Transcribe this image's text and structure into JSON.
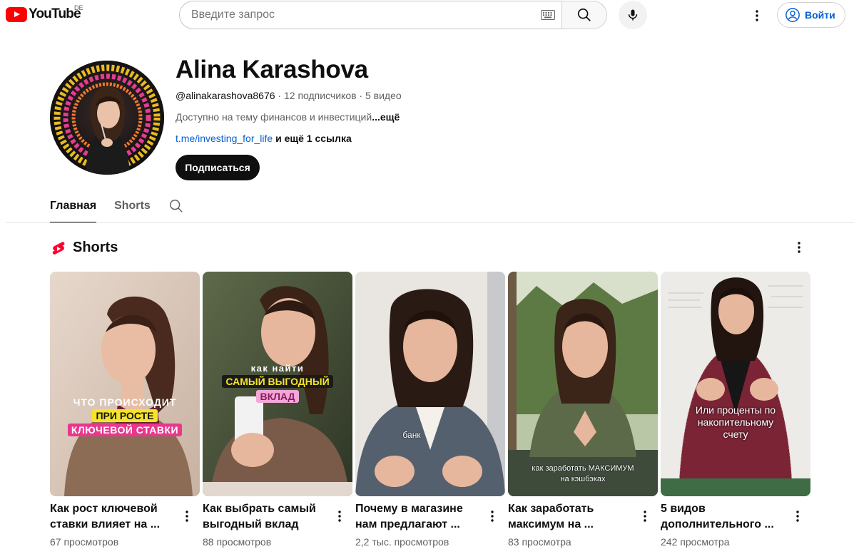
{
  "header": {
    "logo_text": "YouTube",
    "country_code": "DE",
    "search_placeholder": "Введите запрос",
    "signin_label": "Войти"
  },
  "channel": {
    "name": "Alina Karashova",
    "handle": "@alinakarashova8676",
    "subscribers": "12 подписчиков",
    "video_count": "5 видео",
    "meta_separator": " · ",
    "description": "Доступно на  тему финансов и инвестиций",
    "description_more": "...ещё",
    "link": "t.me/investing_for_life",
    "link_extra": " и ещё 1 ссылка",
    "subscribe_label": "Подписаться",
    "avatar_ring_text": "ИНВЕСТИЦИИ ИНВЕСТИЦИИ ИНВЕСТИЦИИ"
  },
  "tabs": [
    {
      "label": "Главная",
      "active": true
    },
    {
      "label": "Shorts",
      "active": false
    }
  ],
  "shelf": {
    "title": "Shorts",
    "items": [
      {
        "title_line1": "Как рост ключевой",
        "title_line2": "ставки влияет на ...",
        "views": "67 просмотров",
        "overlay_line1": "ЧТО ПРОИСХОДИТ",
        "overlay_line2": "ПРИ РОСТЕ",
        "overlay_line3": "КЛЮЧЕВОЙ СТАВКИ"
      },
      {
        "title_line1": "Как выбрать самый",
        "title_line2": "выгодный вклад",
        "views": "88 просмотров",
        "overlay_line1": "как найти",
        "overlay_line2": "САМЫЙ ВЫГОДНЫЙ",
        "overlay_line3": "ВКЛАД"
      },
      {
        "title_line1": "Почему в магазине",
        "title_line2": "нам предлагают ...",
        "views": "2,2 тыс. просмотров",
        "overlay_line1": "банк"
      },
      {
        "title_line1": "Как заработать",
        "title_line2": "максимум на ...",
        "views": "83 просмотра",
        "overlay_line1": "как заработать МАКСИМУМ",
        "overlay_line2": "на кэшбэках"
      },
      {
        "title_line1": "5 видов",
        "title_line2": "дополнительного ...",
        "views": "242 просмотра",
        "overlay_line1": "Или проценты по",
        "overlay_line2": "накопительному",
        "overlay_line3": "счету"
      }
    ]
  },
  "colors": {
    "brand_red": "#ff0000",
    "link_blue": "#065fd4",
    "text_secondary": "#606060",
    "subscribe_bg": "#0f0f0f"
  },
  "icons": [
    "youtube-logo-icon",
    "keyboard-icon",
    "search-icon",
    "mic-icon",
    "more-vert-icon",
    "account-icon",
    "shorts-icon"
  ]
}
